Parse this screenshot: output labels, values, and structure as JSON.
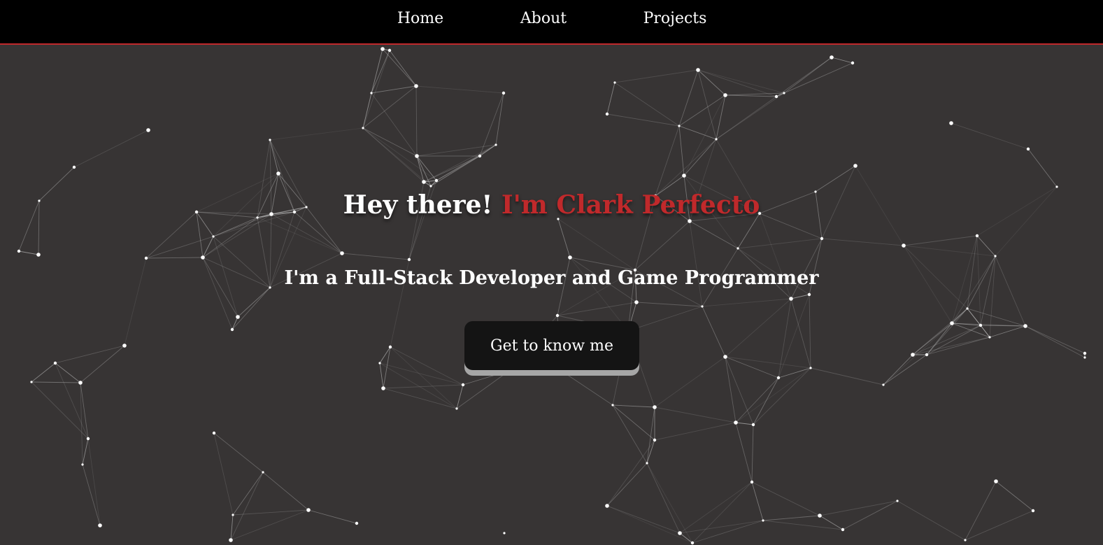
{
  "nav": {
    "links": [
      {
        "label": "Home"
      },
      {
        "label": "About"
      },
      {
        "label": "Projects"
      }
    ]
  },
  "hero": {
    "greeting": "Hey there!",
    "name": "I'm Clark Perfecto",
    "subtitle": "I'm a Full-Stack Developer and Game Programmer",
    "cta_label": "Get to know me"
  },
  "colors": {
    "background": "#373434",
    "navbar": "#000000",
    "accent": "#c0292b",
    "text": "#ffffff",
    "button": "#141414",
    "button_shadow": "#a6a6a6",
    "particle": "#ffffff"
  }
}
